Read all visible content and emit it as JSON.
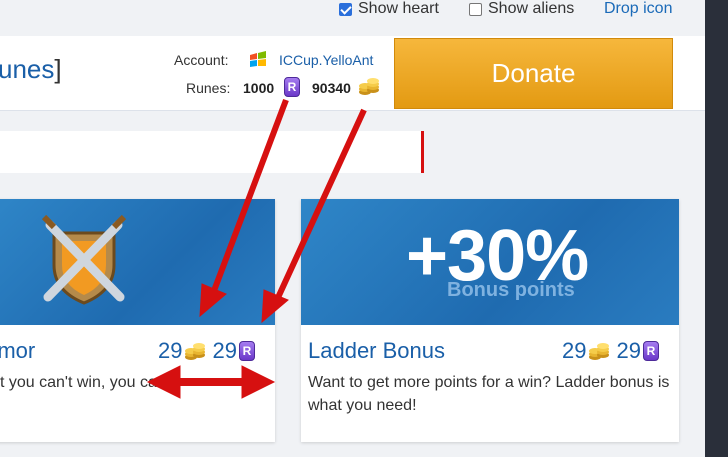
{
  "topbar": {
    "show_heart_label": "Show heart",
    "show_heart_checked": true,
    "show_aliens_label": "Show aliens",
    "show_aliens_checked": false,
    "drop_icon_label": "Drop icon"
  },
  "header": {
    "title_fragment": "unes",
    "title_bracket": "]",
    "account_label": "Account:",
    "account_name": "ICCup.YelloAnt",
    "runes_label": "Runes:",
    "runes_value": "1000",
    "gold_value": "90340",
    "donate_label": "Donate"
  },
  "cards": [
    {
      "title": "rmor",
      "gold_price": "29",
      "rune_price": "29",
      "description": "t you can't win, you ca"
    },
    {
      "title": "Ladder Bonus",
      "banner_big": "+30%",
      "banner_sub": "Bonus points",
      "gold_price": "29",
      "rune_price": "29",
      "description": "Want to get more points for a win? Ladder bonus is what you need!"
    }
  ],
  "icons": {
    "rune_glyph": "R"
  },
  "colors": {
    "accent_link": "#1a5fa8",
    "donate": "#e39a12",
    "annotation_arrow": "#d61010"
  }
}
